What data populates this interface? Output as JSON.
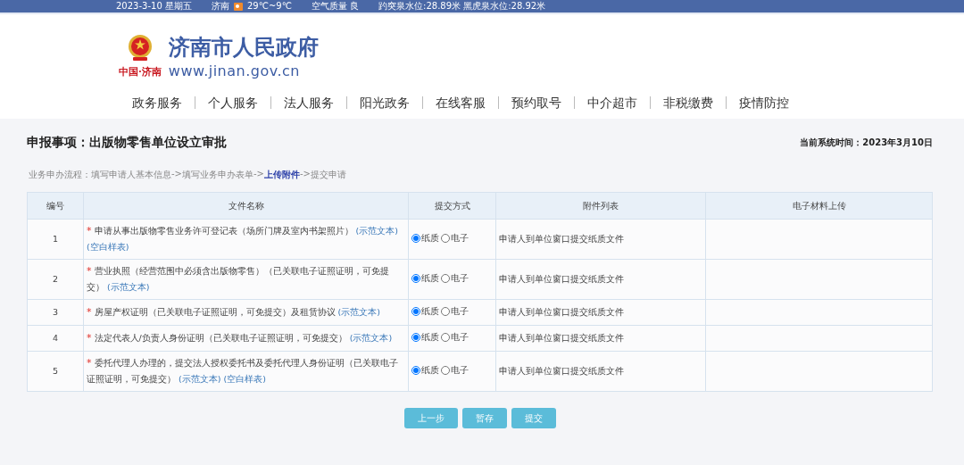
{
  "top_bar": {
    "date": "2023-3-10 星期五",
    "city": "济南",
    "temperature": "29℃~9℃",
    "air_quality": "空气质量 良",
    "water_levels": "趵突泉水位:28.89米 黑虎泉水位:28.92米"
  },
  "header": {
    "logo_caption": "中国·济南",
    "site_title": "济南市人民政府",
    "site_url": "www.jinan.gov.cn"
  },
  "nav": [
    "政务服务",
    "个人服务",
    "法人服务",
    "阳光政务",
    "在线客服",
    "预约取号",
    "中介超市",
    "非税缴费",
    "疫情防控"
  ],
  "page_title": "申报事项：出版物零售单位设立审批",
  "system_time": "当前系统时间：2023年3月10日",
  "process": {
    "label": "业务申办流程：",
    "steps": [
      {
        "label": "填写申请人基本信息",
        "arrow": "->",
        "selected": false
      },
      {
        "label": "填写业务申办表单",
        "arrow": "->",
        "selected": false
      },
      {
        "label": "上传附件",
        "arrow": "->",
        "selected": true
      },
      {
        "label": "提交申请",
        "selected": false
      }
    ]
  },
  "table": {
    "columns": [
      "编号",
      "文件名称",
      "提交方式",
      "附件列表",
      "电子材料上传"
    ],
    "rows": [
      {
        "number": "1",
        "marker": "*",
        "name": "申请从事出版物零售业务许可登记表（场所门牌及室内书架照片）",
        "links": [
          "(示范文本)",
          "(空白样表)"
        ],
        "methods": [
          {
            "label": "纸质",
            "selected": true
          },
          {
            "label": "电子",
            "selected": false
          }
        ],
        "attachment": "申请人到单位窗口提交纸质文件"
      },
      {
        "number": "2",
        "marker": "*",
        "name": "营业执照（经营范围中必须含出版物零售）（已关联电子证照证明，可免提交）",
        "links": [
          "(示范文本)"
        ],
        "methods": [
          {
            "label": "纸质",
            "selected": true
          },
          {
            "label": "电子",
            "selected": false
          }
        ],
        "attachment": "申请人到单位窗口提交纸质文件"
      },
      {
        "number": "3",
        "marker": "*",
        "name": "房屋产权证明（已关联电子证照证明，可免提交）及租赁协议",
        "links": [
          "(示范文本)"
        ],
        "methods": [
          {
            "label": "纸质",
            "selected": true
          },
          {
            "label": "电子",
            "selected": false
          }
        ],
        "attachment": "申请人到单位窗口提交纸质文件"
      },
      {
        "number": "4",
        "marker": "*",
        "name": "法定代表人/负责人身份证明（已关联电子证照证明，可免提交）",
        "links": [
          "(示范文本)"
        ],
        "methods": [
          {
            "label": "纸质",
            "selected": true
          },
          {
            "label": "电子",
            "selected": false
          }
        ],
        "attachment": "申请人到单位窗口提交纸质文件"
      },
      {
        "number": "5",
        "marker": "*",
        "name": "委托代理人办理的，提交法人授权委托书及委托代理人身份证明（已关联电子证照证明，可免提交）",
        "links": [
          "(示范文本)",
          "(空白样表)"
        ],
        "methods": [
          {
            "label": "纸质",
            "selected": true
          },
          {
            "label": "电子",
            "selected": false
          }
        ],
        "attachment": "申请人到单位窗口提交纸质文件"
      }
    ]
  },
  "buttons": [
    "上一步",
    "暂存",
    "提交"
  ]
}
